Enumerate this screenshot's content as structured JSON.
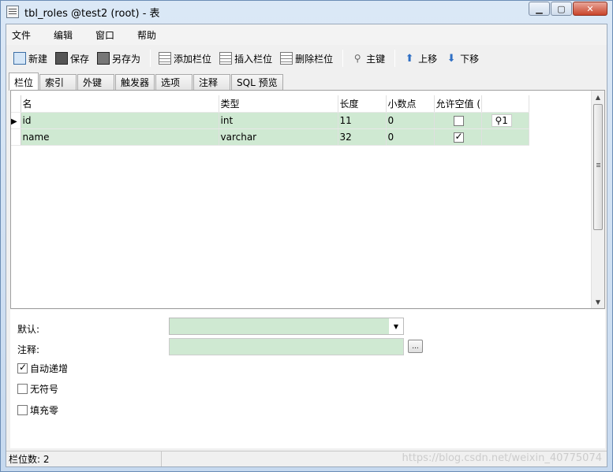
{
  "window": {
    "title": "tbl_roles @test2 (root) - 表",
    "min_icon": "minimize-icon",
    "max_icon": "maximize-icon",
    "close_icon": "close-icon"
  },
  "menu": [
    {
      "label": "文件"
    },
    {
      "label": "编辑"
    },
    {
      "label": "窗口"
    },
    {
      "label": "帮助"
    }
  ],
  "toolbar": {
    "new": "新建",
    "save": "保存",
    "save_as": "另存为",
    "add_field": "添加栏位",
    "insert_field": "插入栏位",
    "delete_field": "删除栏位",
    "primary_key": "主键",
    "move_up": "上移",
    "move_down": "下移"
  },
  "tabs": [
    {
      "label": "栏位",
      "active": true
    },
    {
      "label": "索引"
    },
    {
      "label": "外键"
    },
    {
      "label": "触发器"
    },
    {
      "label": "选项"
    },
    {
      "label": "注释"
    },
    {
      "label": "SQL 预览"
    }
  ],
  "grid": {
    "headers": [
      "名",
      "类型",
      "长度",
      "小数点",
      "允许空值 ("
    ],
    "rows": [
      {
        "name": "id",
        "type": "int",
        "length": "11",
        "decimals": "0",
        "allow_null": false,
        "key": "1"
      },
      {
        "name": "name",
        "type": "varchar",
        "length": "32",
        "decimals": "0",
        "allow_null": true,
        "key": ""
      }
    ]
  },
  "properties": {
    "default_label": "默认:",
    "comment_label": "注释:",
    "dots_label": "...",
    "auto_increment": {
      "label": "自动递增",
      "checked": true
    },
    "unsigned": {
      "label": "无符号",
      "checked": false
    },
    "zerofill": {
      "label": "填充零",
      "checked": false
    }
  },
  "status": {
    "field_count": "栏位数: 2",
    "watermark": "https://blog.csdn.net/weixin_40775074"
  },
  "colors": {
    "row_highlight": "#cfe9d2",
    "title_bg": "#cfe0f3"
  }
}
